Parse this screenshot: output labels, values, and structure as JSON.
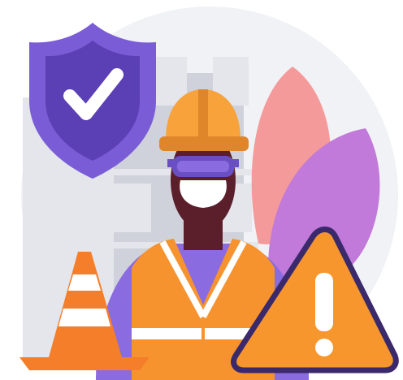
{
  "illustration": {
    "subject": "construction-worker-safety",
    "elements": [
      "background-circle",
      "building",
      "security-shield",
      "pink-leaf",
      "purple-leaf",
      "worker",
      "traffic-cone",
      "warning-sign"
    ]
  },
  "icons": {
    "shield": "shield-check-icon",
    "warning": "warning-triangle-icon",
    "cone": "traffic-cone-icon"
  },
  "colors": {
    "background_circle": "#f1f2f6",
    "building_light": "#e4e6ec",
    "building_mid": "#cfd2da",
    "shield_outer": "#7a5cd6",
    "shield_inner": "#5b3fb5",
    "check": "#ffffff",
    "leaf_pink": "#f59a9a",
    "leaf_purple": "#c17ad9",
    "helmet": "#f7a23a",
    "helmet_shade": "#e0862a",
    "goggles": "#6a4fc4",
    "mask": "#ffffff",
    "skin": "#5a1f2a",
    "shirt": "#8a6be0",
    "vest": "#f7932f",
    "vest_stripe": "#ffffff",
    "cone": "#f57e2a",
    "cone_stripe": "#ffffff",
    "warning_fill": "#f7962d",
    "warning_outline": "#3b2a6b",
    "warning_mark": "#ffffff"
  }
}
